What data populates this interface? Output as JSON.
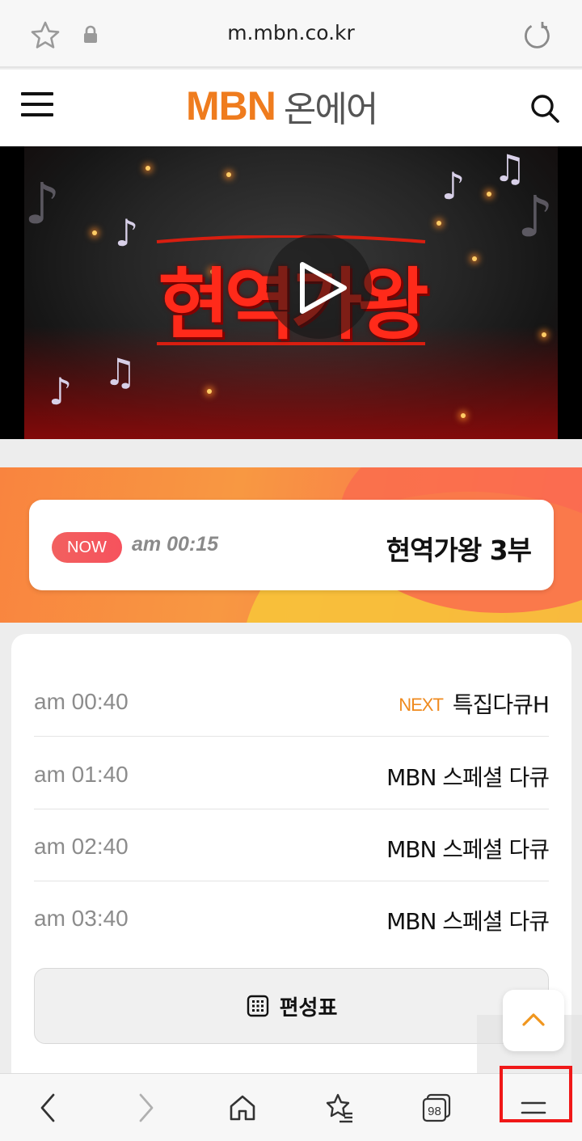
{
  "browser": {
    "url": "m.mbn.co.kr",
    "tab_count": "98"
  },
  "header": {
    "brand": "MBN",
    "subtitle": "온에어"
  },
  "video": {
    "title_art": "현역가왕"
  },
  "now_playing": {
    "badge": "NOW",
    "time": "am 00:15",
    "program": "현역가왕 3부"
  },
  "schedule": {
    "rows": [
      {
        "time": "am 00:40",
        "tag": "NEXT",
        "program": "특집다큐H"
      },
      {
        "time": "am 01:40",
        "tag": "",
        "program": "MBN 스페셜 다큐"
      },
      {
        "time": "am 02:40",
        "tag": "",
        "program": "MBN 스페셜 다큐"
      },
      {
        "time": "am 03:40",
        "tag": "",
        "program": "MBN 스페셜 다큐"
      }
    ],
    "tv_guide_label": "편성표"
  },
  "colors": {
    "brand_orange": "#ef7c1e",
    "now_badge": "#f2605f",
    "next_tag": "#ef8a1e",
    "highlight_box": "#f01818"
  },
  "icons": {
    "bookmark": "star-icon",
    "secure": "lock-icon",
    "reload": "reload-icon",
    "menu": "hamburger-icon",
    "search": "search-icon",
    "play": "play-icon",
    "tv_guide": "calendar-grid-icon",
    "scroll_top": "chevron-up-icon",
    "back": "chevron-left-icon",
    "forward": "chevron-right-icon",
    "home": "home-icon",
    "bookmarks": "star-list-icon",
    "tabs": "tabs-icon",
    "browser_menu": "menu-lines-icon"
  }
}
